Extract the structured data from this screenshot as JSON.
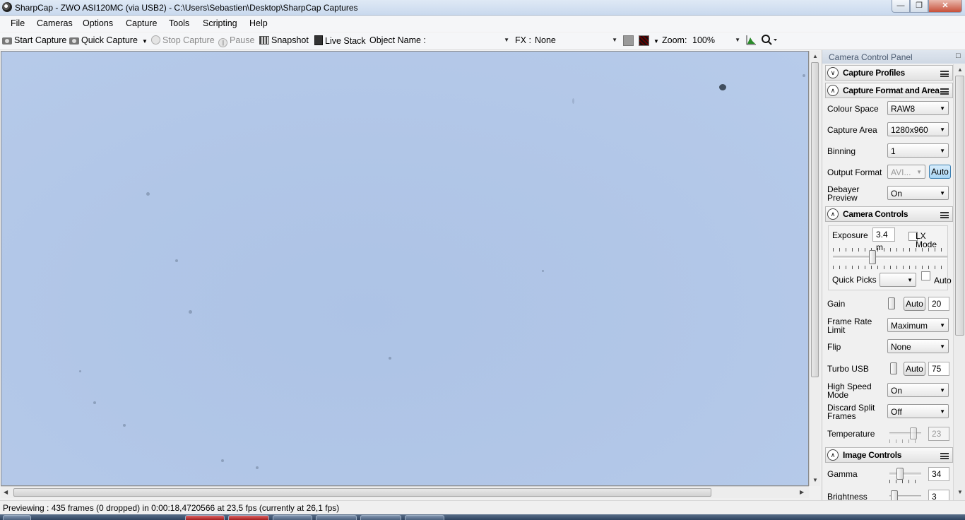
{
  "window": {
    "title": "SharpCap - ZWO ASI120MC (via USB2) - C:\\Users\\Sebastien\\Desktop\\SharpCap Captures",
    "minimize_glyph": "—",
    "maximize_glyph": "❐",
    "close_glyph": "✕"
  },
  "menu": [
    "File",
    "Cameras",
    "Options",
    "Capture",
    "Tools",
    "Scripting",
    "Help"
  ],
  "toolbar": {
    "start_capture": "Start Capture",
    "quick_capture": "Quick Capture",
    "stop_capture": "Stop Capture",
    "pause": "Pause",
    "snapshot": "Snapshot",
    "live_stack": "Live Stack",
    "object_name_label": "Object Name :",
    "object_name_value": "",
    "fx_label": "FX :",
    "fx_value": "None",
    "zoom_label": "Zoom:",
    "zoom_value": "100%",
    "dropdown_glyph": "▼"
  },
  "panel": {
    "title": "Camera Control Panel",
    "pin_glyph": "□",
    "sections": {
      "capture_profiles": "Capture Profiles",
      "capture_format": "Capture Format and Area",
      "camera_controls": "Camera Controls",
      "image_controls": "Image Controls"
    },
    "collapse_glyph": "∧",
    "expand_glyph": "∨",
    "capture_format": {
      "colour_space_label": "Colour Space",
      "colour_space_value": "RAW8",
      "capture_area_label": "Capture Area",
      "capture_area_value": "1280x960",
      "binning_label": "Binning",
      "binning_value": "1",
      "output_format_label": "Output Format",
      "output_format_value": "AVI...",
      "output_format_auto": "Auto",
      "debayer_label_1": "Debayer",
      "debayer_label_2": "Preview",
      "debayer_value": "On"
    },
    "camera_controls": {
      "exposure_label": "Exposure",
      "exposure_value": "3.4 m",
      "lx_mode_label": "LX Mode",
      "quick_picks_label": "Quick Picks",
      "quick_picks_value": "",
      "quick_picks_auto": "Auto",
      "gain_label": "Gain",
      "gain_auto": "Auto",
      "gain_value": "20",
      "frame_rate_label_1": "Frame Rate",
      "frame_rate_label_2": "Limit",
      "frame_rate_value": "Maximum",
      "flip_label": "Flip",
      "flip_value": "None",
      "turbo_usb_label": "Turbo USB",
      "turbo_usb_auto": "Auto",
      "turbo_usb_value": "75",
      "high_speed_label_1": "High Speed",
      "high_speed_label_2": "Mode",
      "high_speed_value": "On",
      "discard_split_label_1": "Discard Split",
      "discard_split_label_2": "Frames",
      "discard_split_value": "Off",
      "temperature_label": "Temperature",
      "temperature_value": "23"
    },
    "image_controls": {
      "gamma_label": "Gamma",
      "gamma_value": "34",
      "brightness_label": "Brightness",
      "brightness_value": "3"
    }
  },
  "status": "Previewing : 435 frames (0 dropped) in 0:00:18,4720566 at 23,5 fps  (currently at 26,1 fps)",
  "colors": {
    "preview_background": "#b1c6e7",
    "auto_active": "#a9d6f5"
  },
  "icons": [
    "app-icon",
    "camera-icon",
    "stop-icon",
    "pause-icon",
    "snapshot-icon",
    "live-stack-icon",
    "histogram-icon",
    "zoom-tool-icon",
    "pin-icon",
    "menu-icon"
  ]
}
